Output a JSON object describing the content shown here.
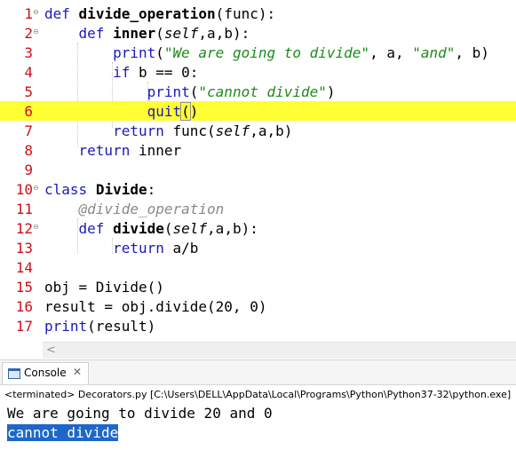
{
  "editor": {
    "lines": [
      {
        "n": "1",
        "t": "def divide_operation(func):"
      },
      {
        "n": "2",
        "t": "    def inner(self,a,b):"
      },
      {
        "n": "3",
        "t": "        print(\"We are going to divide\", a, \"and\", b)"
      },
      {
        "n": "4",
        "t": "        if b == 0:"
      },
      {
        "n": "5",
        "t": "            print(\"cannot divide\")"
      },
      {
        "n": "6",
        "t": "            quit()"
      },
      {
        "n": "7",
        "t": "        return func(self,a,b)"
      },
      {
        "n": "8",
        "t": "    return inner"
      },
      {
        "n": "9",
        "t": ""
      },
      {
        "n": "10",
        "t": "class Divide:"
      },
      {
        "n": "11",
        "t": "    @divide_operation"
      },
      {
        "n": "12",
        "t": "    def divide(self,a,b):"
      },
      {
        "n": "13",
        "t": "        return a/b"
      },
      {
        "n": "14",
        "t": ""
      },
      {
        "n": "15",
        "t": "obj = Divide()"
      },
      {
        "n": "16",
        "t": "result = obj.divide(20, 0)"
      },
      {
        "n": "17",
        "t": "print(result)"
      }
    ],
    "highlight_color": "#ffff33",
    "scroll_left_glyph": "<"
  },
  "console": {
    "tab_label": "Console",
    "close_glyph": "✕",
    "terminated": "<terminated> Decorators.py [C:\\Users\\DELL\\AppData\\Local\\Programs\\Python\\Python37-32\\python.exe]",
    "output": [
      "We are going to divide 20 and 0",
      "cannot divide"
    ],
    "selection_color": "#1e67c9"
  }
}
